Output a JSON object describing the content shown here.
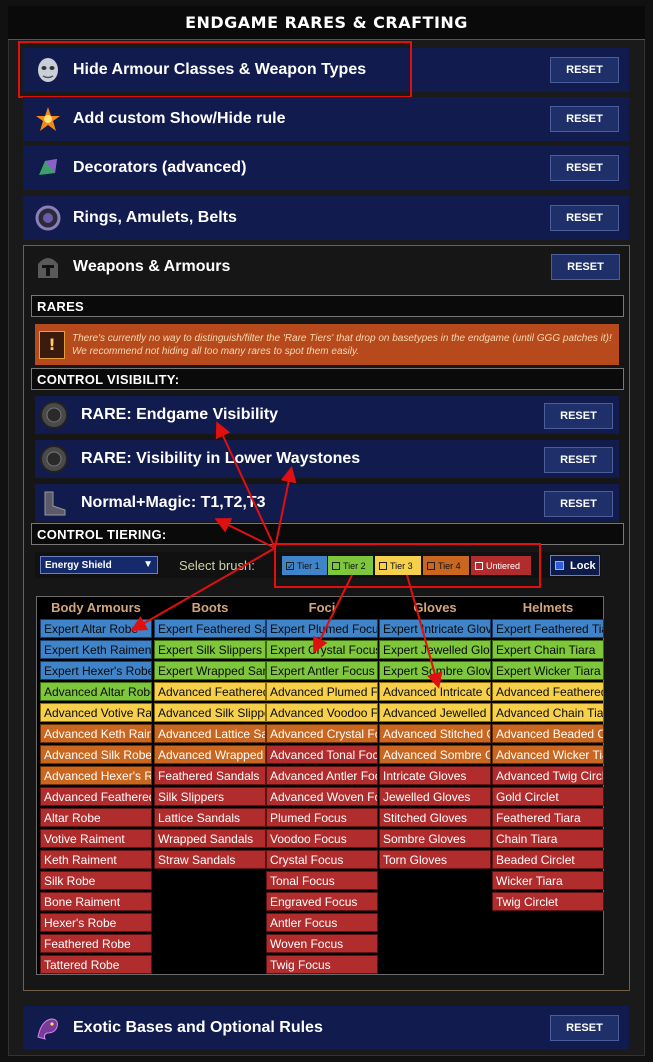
{
  "header": {
    "title": "ENDGAME RARES & CRAFTING"
  },
  "reset_label": "RESET",
  "sections": [
    {
      "label": "Hide Armour Classes & Weapon Types",
      "icon": "mask-icon"
    },
    {
      "label": "Add custom Show/Hide rule",
      "icon": "spark-icon"
    },
    {
      "label": "Decorators (advanced)",
      "icon": "gem-icon"
    },
    {
      "label": "Rings, Amulets, Belts",
      "icon": "ring-icon"
    },
    {
      "label": "Weapons & Armours",
      "icon": "helmet-icon"
    }
  ],
  "bottom_section": {
    "label": "Exotic Bases and Optional Rules",
    "icon": "dragon-icon"
  },
  "rares": {
    "header": "RARES",
    "warning": "There's currently no way to distinguish/filter the 'Rare Tiers' that drop on basetypes in the endgame (until GGG patches it)! We recommend not hiding all too many rares to spot them easily."
  },
  "control_visibility": {
    "header": "CONTROL VISIBILITY:",
    "items": [
      {
        "label": "RARE: Endgame Visibility",
        "icon": "orb-icon"
      },
      {
        "label": "RARE: Visibility in Lower Waystones",
        "icon": "orb-icon"
      },
      {
        "label": "Normal+Magic: T1,T2,T3",
        "icon": "boots-icon"
      }
    ]
  },
  "control_tiering": {
    "header": "CONTROL TIERING:",
    "dropdown_value": "Energy Shield",
    "brush_label": "Select brush:",
    "tiers": [
      {
        "label": "Tier 1",
        "checked": true,
        "color": "#3f83c8"
      },
      {
        "label": "Tier 2",
        "checked": false,
        "color": "#7ec63b"
      },
      {
        "label": "Tier 3",
        "checked": false,
        "color": "#f6d04a"
      },
      {
        "label": "Tier 4",
        "checked": false,
        "color": "#c9661f"
      },
      {
        "label": "Untiered",
        "checked": false,
        "color": "#b12d2d"
      }
    ],
    "lock_label": "Lock"
  },
  "grid": {
    "columns": [
      {
        "header": "Body Armours",
        "items": [
          {
            "name": "Expert Altar Robe",
            "tier": "t1"
          },
          {
            "name": "Expert Keth Raiment",
            "tier": "t1"
          },
          {
            "name": "Expert Hexer's Robe",
            "tier": "t1"
          },
          {
            "name": "Advanced Altar Robe",
            "tier": "t2"
          },
          {
            "name": "Advanced Votive Raiment",
            "tier": "t3"
          },
          {
            "name": "Advanced Keth Raiment",
            "tier": "t4"
          },
          {
            "name": "Advanced Silk Robe",
            "tier": "t4"
          },
          {
            "name": "Advanced Hexer's Robe",
            "tier": "t4"
          },
          {
            "name": "Advanced Feathered Robe",
            "tier": "tu"
          },
          {
            "name": "Altar Robe",
            "tier": "tu"
          },
          {
            "name": "Votive Raiment",
            "tier": "tu"
          },
          {
            "name": "Keth Raiment",
            "tier": "tu"
          },
          {
            "name": "Silk Robe",
            "tier": "tu"
          },
          {
            "name": "Bone Raiment",
            "tier": "tu"
          },
          {
            "name": "Hexer's Robe",
            "tier": "tu"
          },
          {
            "name": "Feathered Robe",
            "tier": "tu"
          },
          {
            "name": "Tattered Robe",
            "tier": "tu"
          }
        ]
      },
      {
        "header": "Boots",
        "items": [
          {
            "name": "Expert Feathered Sandals",
            "tier": "t1"
          },
          {
            "name": "Expert Silk Slippers",
            "tier": "t2"
          },
          {
            "name": "Expert Wrapped Sandals",
            "tier": "t2"
          },
          {
            "name": "Advanced Feathered Sandals",
            "tier": "t3"
          },
          {
            "name": "Advanced Silk Slippers",
            "tier": "t3"
          },
          {
            "name": "Advanced Lattice Sandals",
            "tier": "t4"
          },
          {
            "name": "Advanced Wrapped Sandals",
            "tier": "t4"
          },
          {
            "name": "Feathered Sandals",
            "tier": "tu"
          },
          {
            "name": "Silk Slippers",
            "tier": "tu"
          },
          {
            "name": "Lattice Sandals",
            "tier": "tu"
          },
          {
            "name": "Wrapped Sandals",
            "tier": "tu"
          },
          {
            "name": "Straw Sandals",
            "tier": "tu"
          }
        ]
      },
      {
        "header": "Foci",
        "items": [
          {
            "name": "Expert Plumed Focus",
            "tier": "t1"
          },
          {
            "name": "Expert Crystal Focus",
            "tier": "t2"
          },
          {
            "name": "Expert Antler Focus",
            "tier": "t2"
          },
          {
            "name": "Advanced Plumed Focus",
            "tier": "t3"
          },
          {
            "name": "Advanced Voodoo Focus",
            "tier": "t3"
          },
          {
            "name": "Advanced Crystal Focus",
            "tier": "t4"
          },
          {
            "name": "Advanced Tonal Focus",
            "tier": "tu"
          },
          {
            "name": "Advanced Antler Focus",
            "tier": "tu"
          },
          {
            "name": "Advanced Woven Focus",
            "tier": "tu"
          },
          {
            "name": "Plumed Focus",
            "tier": "tu"
          },
          {
            "name": "Voodoo Focus",
            "tier": "tu"
          },
          {
            "name": "Crystal Focus",
            "tier": "tu"
          },
          {
            "name": "Tonal Focus",
            "tier": "tu"
          },
          {
            "name": "Engraved Focus",
            "tier": "tu"
          },
          {
            "name": "Antler Focus",
            "tier": "tu"
          },
          {
            "name": "Woven Focus",
            "tier": "tu"
          },
          {
            "name": "Twig Focus",
            "tier": "tu"
          }
        ]
      },
      {
        "header": "Gloves",
        "items": [
          {
            "name": "Expert Intricate Gloves",
            "tier": "t1"
          },
          {
            "name": "Expert Jewelled Gloves",
            "tier": "t2"
          },
          {
            "name": "Expert Sombre Gloves",
            "tier": "t2"
          },
          {
            "name": "Advanced Intricate Gloves",
            "tier": "t3"
          },
          {
            "name": "Advanced Jewelled Gloves",
            "tier": "t3"
          },
          {
            "name": "Advanced Stitched Gloves",
            "tier": "t4"
          },
          {
            "name": "Advanced Sombre Gloves",
            "tier": "t4"
          },
          {
            "name": "Intricate Gloves",
            "tier": "tu"
          },
          {
            "name": "Jewelled Gloves",
            "tier": "tu"
          },
          {
            "name": "Stitched Gloves",
            "tier": "tu"
          },
          {
            "name": "Sombre Gloves",
            "tier": "tu"
          },
          {
            "name": "Torn Gloves",
            "tier": "tu"
          }
        ]
      },
      {
        "header": "Helmets",
        "items": [
          {
            "name": "Expert Feathered Tiara",
            "tier": "t1"
          },
          {
            "name": "Expert Chain Tiara",
            "tier": "t2"
          },
          {
            "name": "Expert Wicker Tiara",
            "tier": "t2"
          },
          {
            "name": "Advanced Feathered Tiara",
            "tier": "t3"
          },
          {
            "name": "Advanced Chain Tiara",
            "tier": "t3"
          },
          {
            "name": "Advanced Beaded Circlet",
            "tier": "t4"
          },
          {
            "name": "Advanced Wicker Tiara",
            "tier": "t4"
          },
          {
            "name": "Advanced Twig Circlet",
            "tier": "tu"
          },
          {
            "name": "Gold Circlet",
            "tier": "tu"
          },
          {
            "name": "Feathered Tiara",
            "tier": "tu"
          },
          {
            "name": "Chain Tiara",
            "tier": "tu"
          },
          {
            "name": "Beaded Circlet",
            "tier": "tu"
          },
          {
            "name": "Wicker Tiara",
            "tier": "tu"
          },
          {
            "name": "Twig Circlet",
            "tier": "tu"
          }
        ]
      }
    ]
  }
}
